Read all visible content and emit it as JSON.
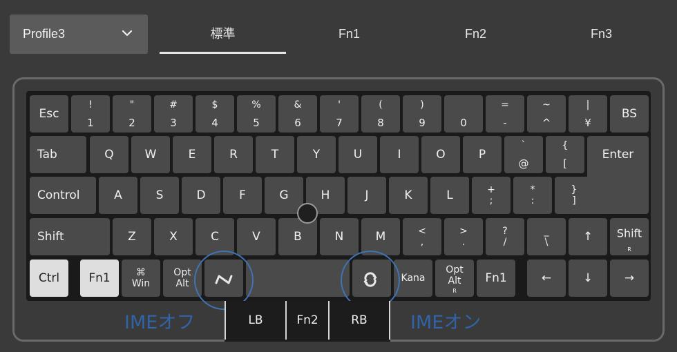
{
  "profile": {
    "selected": "Profile3"
  },
  "tabs": [
    {
      "label": "標準",
      "active": true
    },
    {
      "label": "Fn1",
      "active": false
    },
    {
      "label": "Fn2",
      "active": false
    },
    {
      "label": "Fn3",
      "active": false
    }
  ],
  "keys": {
    "esc": "Esc",
    "n1_top": "!",
    "n1_bot": "1",
    "n2_top": "\"",
    "n2_bot": "2",
    "n3_top": "#",
    "n3_bot": "3",
    "n4_top": "$",
    "n4_bot": "4",
    "n5_top": "%",
    "n5_bot": "5",
    "n6_top": "&",
    "n6_bot": "6",
    "n7_top": "'",
    "n7_bot": "7",
    "n8_top": "(",
    "n8_bot": "8",
    "n9_top": ")",
    "n9_bot": "9",
    "n0_bot": "0",
    "minus_top": "=",
    "minus_bot": "-",
    "caret_top": "~",
    "caret_bot": "^",
    "yen_top": "|",
    "yen_bot": "¥",
    "bs": "BS",
    "tab": "Tab",
    "q": "Q",
    "w": "W",
    "e": "E",
    "r": "R",
    "t": "T",
    "y": "Y",
    "u": "U",
    "i": "I",
    "o": "O",
    "p": "P",
    "at_top": "`",
    "at_bot": "@",
    "lbracket_top": "{",
    "lbracket_bot": "[",
    "enter": "Enter",
    "control": "Control",
    "a": "A",
    "s": "S",
    "d": "D",
    "f": "F",
    "g": "G",
    "h": "H",
    "j": "J",
    "k": "K",
    "l": "L",
    "semi_top": "+",
    "semi_bot": ";",
    "colon_top": "*",
    "colon_bot": ":",
    "rbracket_top": "}",
    "rbracket_bot": "]",
    "shift": "Shift",
    "z": "Z",
    "x": "X",
    "c": "C",
    "v": "V",
    "b": "B",
    "n": "N",
    "m": "M",
    "comma_top": "<",
    "comma_bot": ",",
    "period_top": ">",
    "period_bot": ".",
    "slash_top": "?",
    "slash_bot": "/",
    "ro_top": "_",
    "ro_bot": "\\",
    "up": "↑",
    "shift_r": "Shift",
    "shift_r_sub": "R",
    "ctrl": "Ctrl",
    "fn1": "Fn1",
    "win_top": "⌘",
    "win_bot": "Win",
    "opt_top": "Opt",
    "opt_bot": "Alt",
    "kana": "Kana",
    "opt_r_top": "Opt",
    "opt_r_bot": "Alt",
    "opt_r_sub": "R",
    "fn1_r": "Fn1",
    "left": "←",
    "down": "↓",
    "right": "→"
  },
  "thumb": {
    "lb": "LB",
    "fn2": "Fn2",
    "rb": "RB"
  },
  "annotations": {
    "ime_off": "IMEオフ",
    "ime_on": "IMEオン",
    "color": "#2f64a8"
  },
  "icons": {
    "profile_dropdown": "chevron-down-icon",
    "muhenkan": "ime-off-key-icon",
    "henkan": "ime-on-key-icon"
  }
}
